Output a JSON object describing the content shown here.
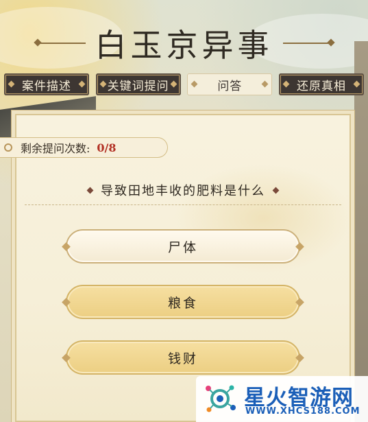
{
  "game": {
    "title": "白玉京异事"
  },
  "tabs": [
    {
      "label": "案件描述",
      "active": false
    },
    {
      "label": "关键词提问",
      "active": false
    },
    {
      "label": "问答",
      "active": true
    },
    {
      "label": "还原真相",
      "active": false
    }
  ],
  "counter": {
    "label": "剩余提问次数:",
    "value": "0/8"
  },
  "question": {
    "text": "导致田地丰收的肥料是什么"
  },
  "answers": [
    {
      "label": "尸体",
      "selected": true
    },
    {
      "label": "粮食",
      "selected": false
    },
    {
      "label": "钱财",
      "selected": false
    }
  ],
  "watermark": {
    "name": "星火智游网",
    "url": "WWW.XHCS188.COM"
  },
  "colors": {
    "tab_dark": "#3d3632",
    "tab_light": "#f4eedb",
    "counter_value": "#b22f23",
    "answer_gold": "#eccf83",
    "answer_selected": "#fffaee",
    "watermark_blue": "#1b5fb8"
  }
}
